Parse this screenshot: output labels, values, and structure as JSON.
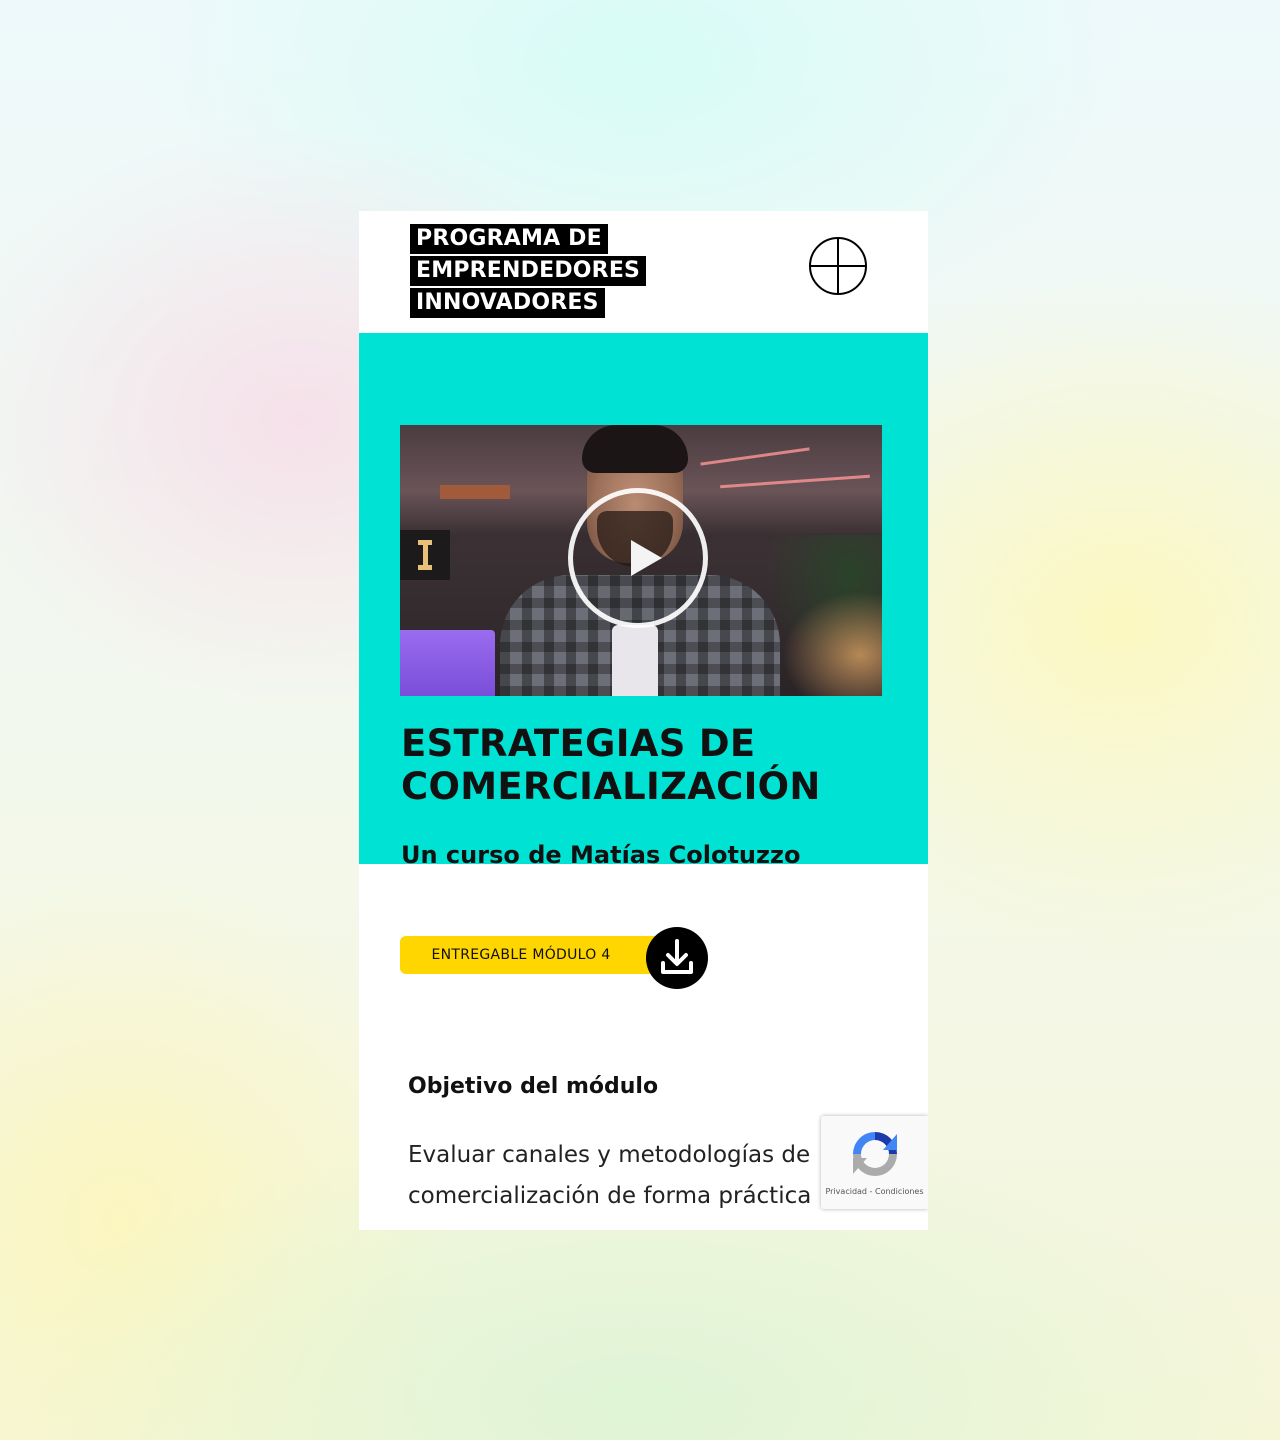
{
  "header": {
    "logo_lines": [
      "PROGRAMA DE",
      "EMPRENDEDORES",
      "INNOVADORES"
    ],
    "menu_icon": "crosshair-menu-icon"
  },
  "hero": {
    "video": {
      "thumbnail": "instructor-video-thumbnail",
      "play_icon": "play-icon"
    },
    "title": "ESTRATEGIAS DE COMERCIALIZACIÓN",
    "subtitle": "Un curso de Matías Colotuzzo"
  },
  "download": {
    "label": "ENTREGABLE MÓDULO 4",
    "icon": "download-icon"
  },
  "objective": {
    "heading": "Objetivo del módulo",
    "text": "Evaluar canales y metodologías de comercialización de forma práctica"
  },
  "recaptcha": {
    "privacy": "Privacidad",
    "separator": "-",
    "terms": "Condiciones"
  },
  "colors": {
    "hero_bg": "#00e2d3",
    "download_pill": "#ffd600",
    "logo_bg": "#000000"
  }
}
